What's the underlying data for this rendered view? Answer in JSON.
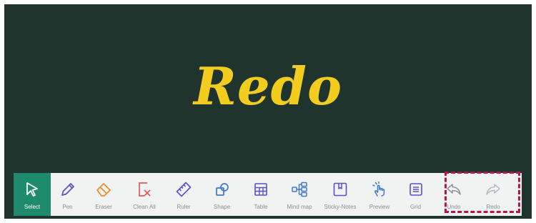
{
  "canvas": {
    "text": "Redo"
  },
  "toolbar": {
    "tools": [
      {
        "label": "Select",
        "icon": "cursor-icon",
        "active": true
      },
      {
        "label": "Pen",
        "icon": "pen-icon"
      },
      {
        "label": "Eraser",
        "icon": "eraser-icon"
      },
      {
        "label": "Clean All",
        "icon": "clean-all-icon"
      },
      {
        "label": "Ruler",
        "icon": "ruler-icon"
      },
      {
        "label": "Shape",
        "icon": "shape-icon"
      },
      {
        "label": "Table",
        "icon": "table-icon"
      },
      {
        "label": "Mind map",
        "icon": "mind-map-icon"
      },
      {
        "label": "Sticky-Notes",
        "icon": "sticky-notes-icon"
      },
      {
        "label": "Preview",
        "icon": "preview-icon"
      },
      {
        "label": "Grid",
        "icon": "grid-icon"
      },
      {
        "label": "Undo",
        "icon": "undo-icon"
      },
      {
        "label": "Redo",
        "icon": "redo-icon"
      }
    ]
  },
  "colors": {
    "board": "#1f342c",
    "canvas_text": "#f2cc1e",
    "toolbar": "#f1f2f2",
    "active_tool": "#1e8a6e",
    "icon_purple": "#5a4fc8",
    "icon_orange": "#ef8a2a",
    "icon_red": "#e05a5a",
    "icon_blue": "#3f79c9",
    "icon_gray": "#8c939c",
    "highlight_border": "#b8154a"
  }
}
